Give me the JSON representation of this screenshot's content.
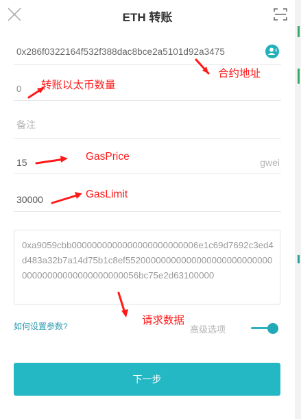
{
  "header": {
    "title": "ETH 转账"
  },
  "form": {
    "contract_address": "0x286f0322164f532f388dac8bce2a5101d92a3475",
    "amount": "0",
    "memo_placeholder": "备注",
    "gas_price": "15",
    "gas_price_unit": "gwei",
    "gas_limit": "30000",
    "data": "0xa9059cbb0000000000000000000000006e1c69d7692c3ed4d483a32b7a14d75b1c8ef5520000000000000000000000000000000000000000000000056bc75e2d63100000"
  },
  "footer": {
    "help_link": "如何设置参数?",
    "advanced_label": "高级选项",
    "advanced_enabled": true,
    "next_button": "下一步"
  },
  "annotations": {
    "contract_address": "合约地址",
    "amount": "转账以太币数量",
    "gas_price": "GasPrice",
    "gas_limit": "GasLimit",
    "data": "请求数据"
  },
  "colors": {
    "accent": "#24b7c4",
    "annotation": "#ff1a1a"
  },
  "icons": {
    "close": "close-icon",
    "scan": "scan-icon",
    "contact": "contact-icon"
  }
}
